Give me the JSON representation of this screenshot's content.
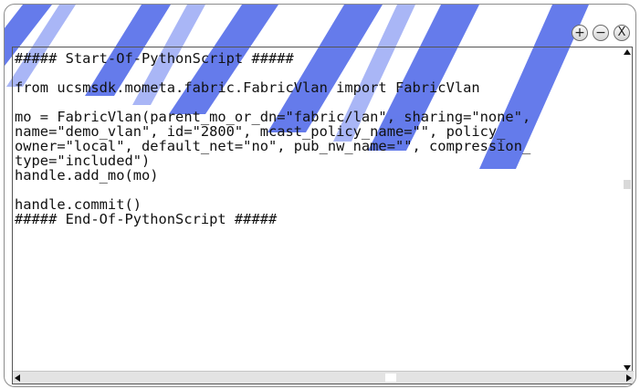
{
  "window": {
    "buttons": {
      "zoom_in": "+",
      "zoom_out": "−",
      "close": "X"
    }
  },
  "editor": {
    "lines": [
      "##### Start-Of-PythonScript #####",
      "",
      "from ucsmsdk.mometa.fabric.FabricVlan import FabricVlan",
      "",
      "mo = FabricVlan(parent_mo_or_dn=\"fabric/lan\", sharing=\"none\",",
      "name=\"demo_vlan\", id=\"2800\", mcast_policy_name=\"\", policy_",
      "owner=\"local\", default_net=\"no\", pub_nw_name=\"\", compression_",
      "type=\"included\")",
      "handle.add_mo(mo)",
      "",
      "handle.commit()",
      "##### End-Of-PythonScript #####"
    ]
  },
  "colors": {
    "chevron": "#4a64e8",
    "border": "#555555"
  }
}
